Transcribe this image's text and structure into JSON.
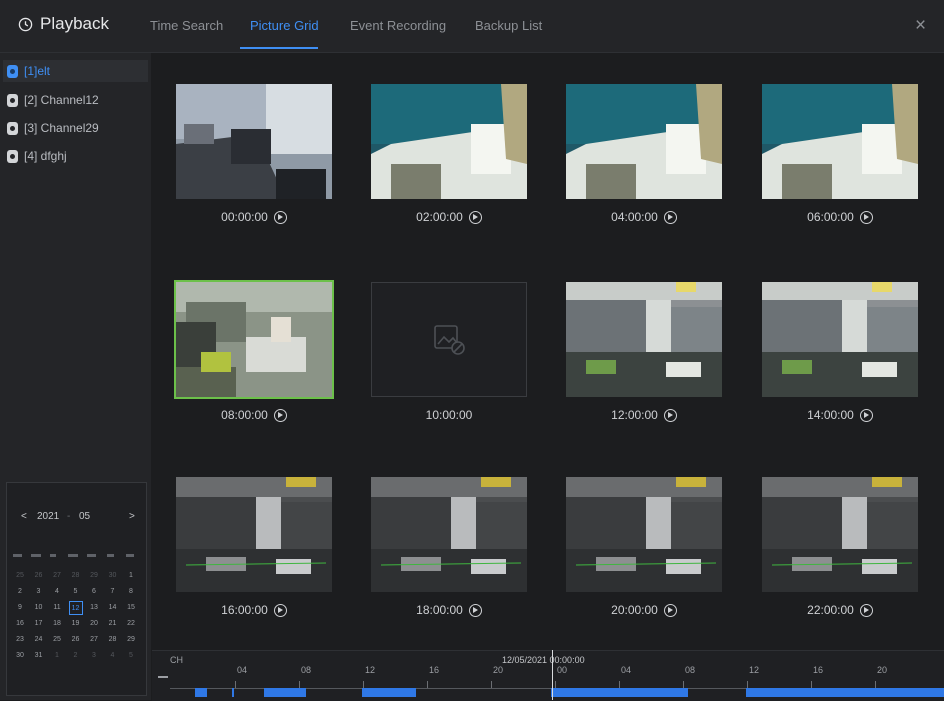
{
  "header": {
    "title": "Playback",
    "tabs": [
      {
        "label": "Time Search",
        "active": false
      },
      {
        "label": "Picture Grid",
        "active": true
      },
      {
        "label": "Event Recording",
        "active": false
      },
      {
        "label": "Backup List",
        "active": false
      }
    ],
    "close_icon": "×"
  },
  "sidebar": {
    "channels": [
      {
        "label": "[1]elt",
        "selected": true
      },
      {
        "label": "[2] Channel12",
        "selected": false
      },
      {
        "label": "[3] Channel29",
        "selected": false
      },
      {
        "label": "[4] dfghj",
        "selected": false
      }
    ]
  },
  "calendar": {
    "year": "2021",
    "month": "05",
    "prev": "<",
    "next": ">",
    "days": [
      {
        "d": "25",
        "dim": true
      },
      {
        "d": "26",
        "dim": true
      },
      {
        "d": "27",
        "dim": true
      },
      {
        "d": "28",
        "dim": true
      },
      {
        "d": "29",
        "dim": true
      },
      {
        "d": "30",
        "dim": true
      },
      {
        "d": "1",
        "dim": false
      },
      {
        "d": "2",
        "dim": false
      },
      {
        "d": "3",
        "dim": false
      },
      {
        "d": "4",
        "dim": false
      },
      {
        "d": "5",
        "dim": false
      },
      {
        "d": "6",
        "dim": false
      },
      {
        "d": "7",
        "dim": false
      },
      {
        "d": "8",
        "dim": false
      },
      {
        "d": "9",
        "dim": false
      },
      {
        "d": "10",
        "dim": false
      },
      {
        "d": "11",
        "dim": false
      },
      {
        "d": "12",
        "dim": false,
        "today": true
      },
      {
        "d": "13",
        "dim": false
      },
      {
        "d": "14",
        "dim": false
      },
      {
        "d": "15",
        "dim": false
      },
      {
        "d": "16",
        "dim": false
      },
      {
        "d": "17",
        "dim": false
      },
      {
        "d": "18",
        "dim": false
      },
      {
        "d": "19",
        "dim": false
      },
      {
        "d": "20",
        "dim": false
      },
      {
        "d": "21",
        "dim": false
      },
      {
        "d": "22",
        "dim": false
      },
      {
        "d": "23",
        "dim": false
      },
      {
        "d": "24",
        "dim": false
      },
      {
        "d": "25",
        "dim": false
      },
      {
        "d": "26",
        "dim": false
      },
      {
        "d": "27",
        "dim": false
      },
      {
        "d": "28",
        "dim": false
      },
      {
        "d": "29",
        "dim": false
      },
      {
        "d": "30",
        "dim": false
      },
      {
        "d": "31",
        "dim": false
      },
      {
        "d": "1",
        "dim": true
      },
      {
        "d": "2",
        "dim": true
      },
      {
        "d": "3",
        "dim": true
      },
      {
        "d": "4",
        "dim": true
      },
      {
        "d": "5",
        "dim": true
      }
    ]
  },
  "grid": {
    "items": [
      {
        "time": "00:00:00",
        "has_play": true,
        "scene": "office-tilt",
        "selected": false
      },
      {
        "time": "02:00:00",
        "has_play": true,
        "scene": "ceiling-bright",
        "selected": false
      },
      {
        "time": "04:00:00",
        "has_play": true,
        "scene": "ceiling-bright",
        "selected": false
      },
      {
        "time": "06:00:00",
        "has_play": true,
        "scene": "ceiling-bright",
        "selected": false
      },
      {
        "time": "08:00:00",
        "has_play": true,
        "scene": "office-desk",
        "selected": true
      },
      {
        "time": "10:00:00",
        "has_play": false,
        "scene": "empty",
        "selected": false
      },
      {
        "time": "12:00:00",
        "has_play": true,
        "scene": "office-wide",
        "selected": false
      },
      {
        "time": "14:00:00",
        "has_play": true,
        "scene": "office-wide",
        "selected": false
      },
      {
        "time": "16:00:00",
        "has_play": true,
        "scene": "office-night",
        "selected": false
      },
      {
        "time": "18:00:00",
        "has_play": true,
        "scene": "office-night",
        "selected": false
      },
      {
        "time": "20:00:00",
        "has_play": true,
        "scene": "office-night",
        "selected": false
      },
      {
        "time": "22:00:00",
        "has_play": true,
        "scene": "office-night",
        "selected": false
      }
    ]
  },
  "timeline": {
    "channel_label": "CH",
    "current_time": "12/05/2021 00:00:00",
    "tick_labels": [
      "04",
      "08",
      "12",
      "16",
      "20",
      "00",
      "04",
      "08",
      "12",
      "16",
      "20"
    ]
  },
  "colors": {
    "accent": "#3f8ff4",
    "selected_outline": "#6cc04a",
    "record": "#2f78e6"
  }
}
